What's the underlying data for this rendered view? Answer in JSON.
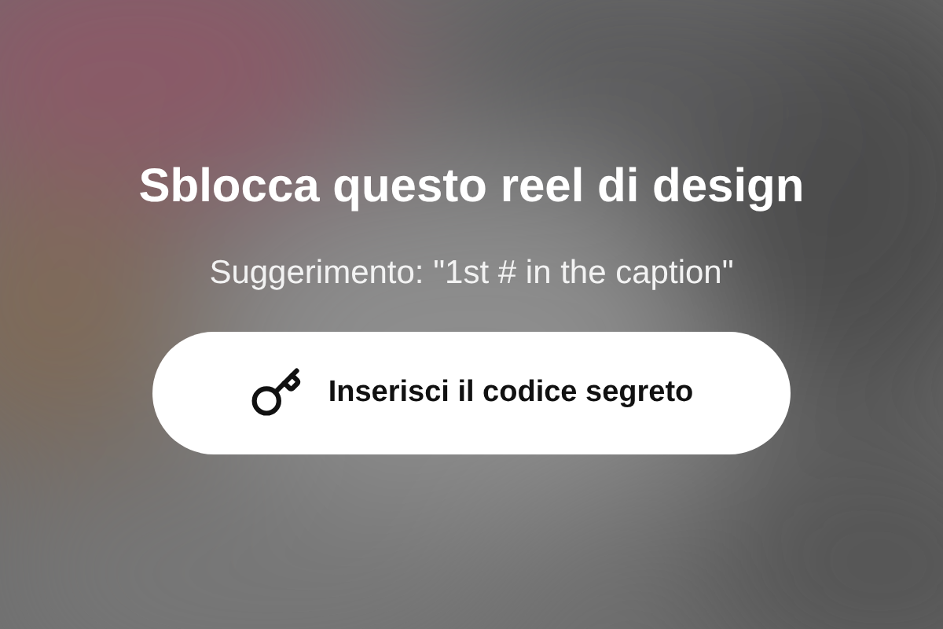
{
  "title": "Sblocca questo reel di design",
  "hint": "Suggerimento: \"1st # in the caption\"",
  "button": {
    "label": "Inserisci il codice segreto"
  }
}
